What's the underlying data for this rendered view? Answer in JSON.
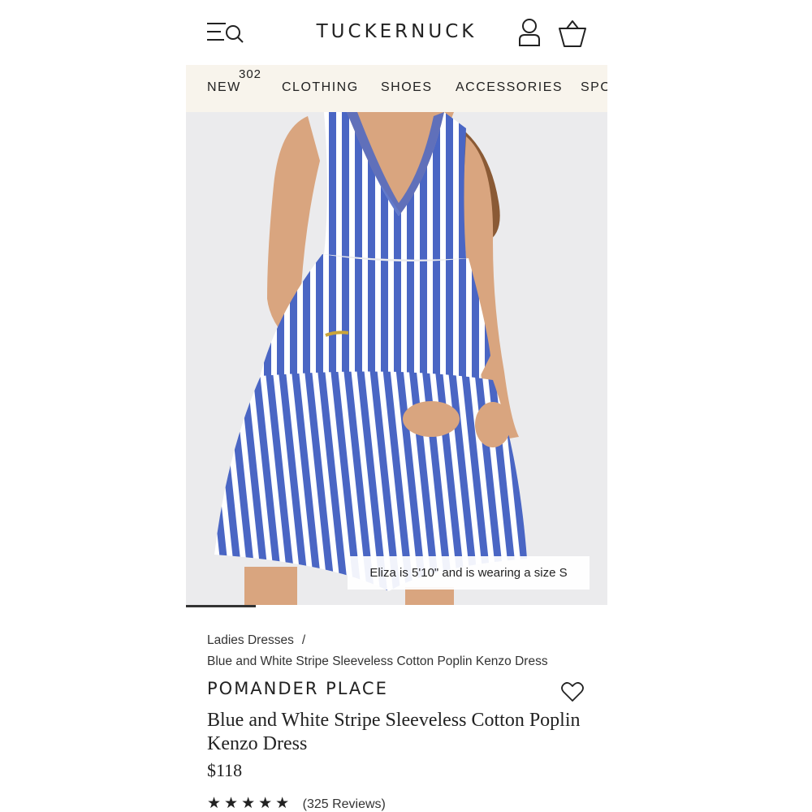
{
  "header": {
    "logo": "TUCKERNUCK",
    "icons": [
      "menu-search-icon",
      "account-icon",
      "bag-icon"
    ]
  },
  "nav": {
    "new_badge": "302",
    "items": [
      "NEW",
      "CLOTHING",
      "SHOES",
      "ACCESSORIES",
      "SPO"
    ]
  },
  "hero": {
    "caption": "Eliza is 5'10\" and is wearing a size S",
    "dress_stripe_colors": [
      "#4a66c4",
      "#ffffff"
    ],
    "background_color": "#ebebed"
  },
  "breadcrumb": {
    "parent": "Ladies Dresses",
    "separator": "/",
    "current": "Blue and White Stripe Sleeveless Cotton Poplin Kenzo Dress"
  },
  "product": {
    "brand": "POMANDER PLACE",
    "title": "Blue and White Stripe Sleeveless Cotton Poplin Kenzo Dress",
    "price": "$118",
    "rating_stars": "★★★★★",
    "reviews": "(325 Reviews)",
    "favorite_icon": "heart-icon"
  }
}
